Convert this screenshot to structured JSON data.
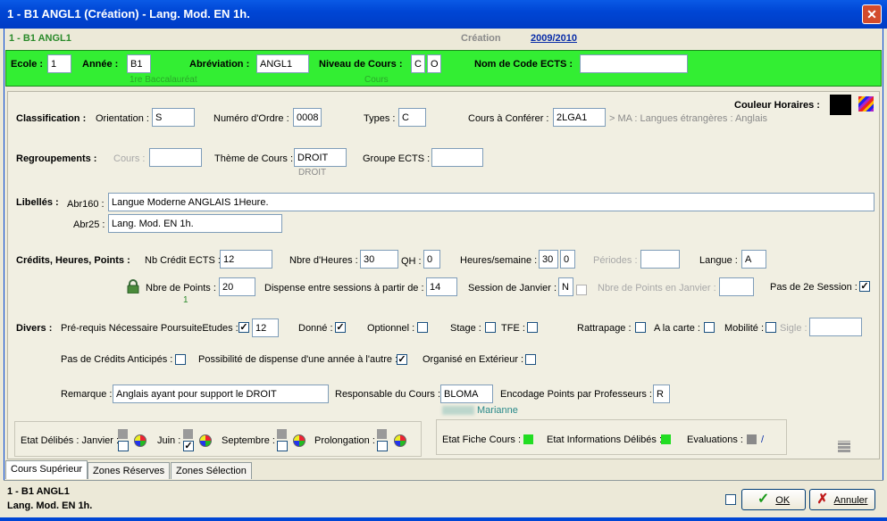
{
  "window": {
    "title": "1 - B1    ANGL1 (Création) - Lang. Mod. EN 1h.",
    "close_glyph": "✕"
  },
  "infobar": {
    "code": "1 - B1    ANGL1",
    "mode_label": "Création",
    "year": "2009/2010"
  },
  "greenbar": {
    "ecole_label": "Ecole :",
    "ecole_value": "1",
    "annee_label": "Année :",
    "annee_value": "B1",
    "annee_hint": "1re Baccalauréat",
    "abrev_label": "Abréviation :",
    "abrev_value": "ANGL1",
    "niveau_label": "Niveau de Cours :",
    "niveau_value1": "C",
    "niveau_value2": "O",
    "niveau_hint": "Cours",
    "ects_label": "Nom de Code ECTS :",
    "ects_value": ""
  },
  "couleur_label": "Couleur Horaires :",
  "classification": {
    "label": "Classification :",
    "orientation_label": "Orientation :",
    "orientation_value": "S",
    "ordre_label": "Numéro d'Ordre :",
    "ordre_value": "0008",
    "types_label": "Types :",
    "types_value": "C",
    "conferer_label": "Cours à Conférer :",
    "conferer_value": "2LGA1",
    "conferer_hint": "> MA : Langues étrangères : Anglais"
  },
  "regroupements": {
    "label": "Regroupements :",
    "cours_label": "Cours :",
    "cours_value": "",
    "theme_label": "Thème de Cours :",
    "theme_value": "DROIT",
    "theme_hint": "DROIT",
    "groupe_label": "Groupe ECTS :",
    "groupe_value": ""
  },
  "libelles": {
    "label": "Libellés :",
    "abr160_label": "Abr160 :",
    "abr160_value": "Langue Moderne ANGLAIS 1Heure.",
    "abr25_label": "Abr25 :",
    "abr25_value": "Lang. Mod. EN 1h."
  },
  "credits": {
    "label": "Crédits, Heures, Points :",
    "nb_ects_label": "Nb Crédit ECTS :",
    "nb_ects_value": "12",
    "heures_label": "Nbre d'Heures :",
    "heures_value": "30",
    "qh_label": "QH :",
    "qh_value": "0",
    "hsem_label": "Heures/semaine :",
    "hsem_value1": "30",
    "hsem_value2": "0",
    "periodes_label": "Périodes :",
    "periodes_value": "",
    "langue_label": "Langue :",
    "langue_value": "A",
    "points_label": "Nbre de Points :",
    "points_value": "20",
    "points_hint": "1",
    "dispense_label": "Dispense entre sessions à partir de :",
    "dispense_value": "14",
    "session_label": "Session de Janvier :",
    "session_value": "N",
    "points_janv_label": "Nbre de Points en Janvier :",
    "points_janv_value": "",
    "pas2_label": "Pas de 2e Session :"
  },
  "divers": {
    "label": "Divers :",
    "prereq_label": "Pré-requis Nécessaire PoursuiteEtudes :",
    "prereq_value": "12",
    "donne_label": "Donné :",
    "optionnel_label": "Optionnel :",
    "stage_label": "Stage :",
    "tfe_label": "TFE :",
    "rattrapage_label": "Rattrapage :",
    "carte_label": "A la carte :",
    "mobilite_label": "Mobilité :",
    "sigle_label": "Sigle :",
    "sigle_value": "",
    "anticipes_label": "Pas de Crédits Anticipés :",
    "dispense_annee_label": "Possibilité de dispense d'une année à l'autre :",
    "exterieur_label": "Organisé en Extérieur :",
    "remarque_label": "Remarque :",
    "remarque_value": "Anglais ayant pour support le DROIT",
    "responsable_label": "Responsable du Cours :",
    "responsable_value": "BLOMA",
    "responsable_hint": "Marianne",
    "encodage_label": "Encodage Points par Professeurs :",
    "encodage_value": "R"
  },
  "etat": {
    "deliberes_label": "Etat Délibés : Janvier :",
    "juin_label": "Juin :",
    "septembre_label": "Septembre :",
    "prolongation_label": "Prolongation :",
    "fiche_label": "Etat Fiche Cours :",
    "info_label": "Etat Informations Délibés :",
    "eval_label": "Evaluations :",
    "eval_value": "/"
  },
  "tabs": [
    "Cours Supérieur",
    "Zones Réserves",
    "Zones Sélection"
  ],
  "footer": {
    "line1": "1 - B1    ANGL1",
    "line2": "Lang. Mod. EN 1h.",
    "ok_label": "OK",
    "cancel_label": "Annuler"
  },
  "colors": {
    "green": "#33ee33",
    "status_green": "#22dd22",
    "title_blue": "#0046d5"
  },
  "check_glyph": "✓"
}
